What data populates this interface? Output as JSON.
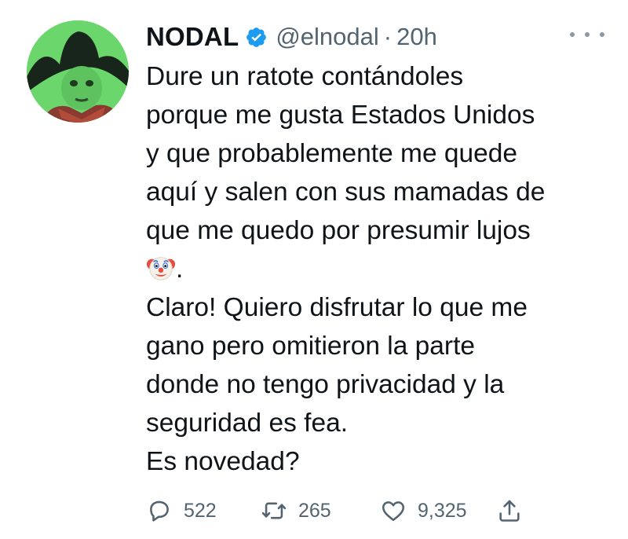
{
  "author": {
    "name": "NODAL",
    "handle": "@elnodal",
    "separator": "·",
    "time": "20h",
    "verified": true,
    "avatar": "cowboy-child-avatar"
  },
  "tweet": {
    "lines": [
      "Dure un ratote contándoles",
      "porque me gusta Estados Unidos",
      "y que probablemente me quede",
      "aquí y salen con sus mamadas de",
      "que me quedo por presumir lujos",
      ".",
      "Claro! Quiero disfrutar lo que me",
      "gano pero omitieron la parte",
      "donde no tengo privacidad y la",
      "seguridad es fea.",
      "Es novedad?"
    ],
    "emoji": "clown-face-icon"
  },
  "actions": {
    "replies": "522",
    "retweets": "265",
    "likes": "9,325"
  },
  "colors": {
    "verified": "#1d9bf0",
    "muted": "#536471",
    "text": "#0f1419",
    "avatar_bg": "#6bd66b"
  }
}
